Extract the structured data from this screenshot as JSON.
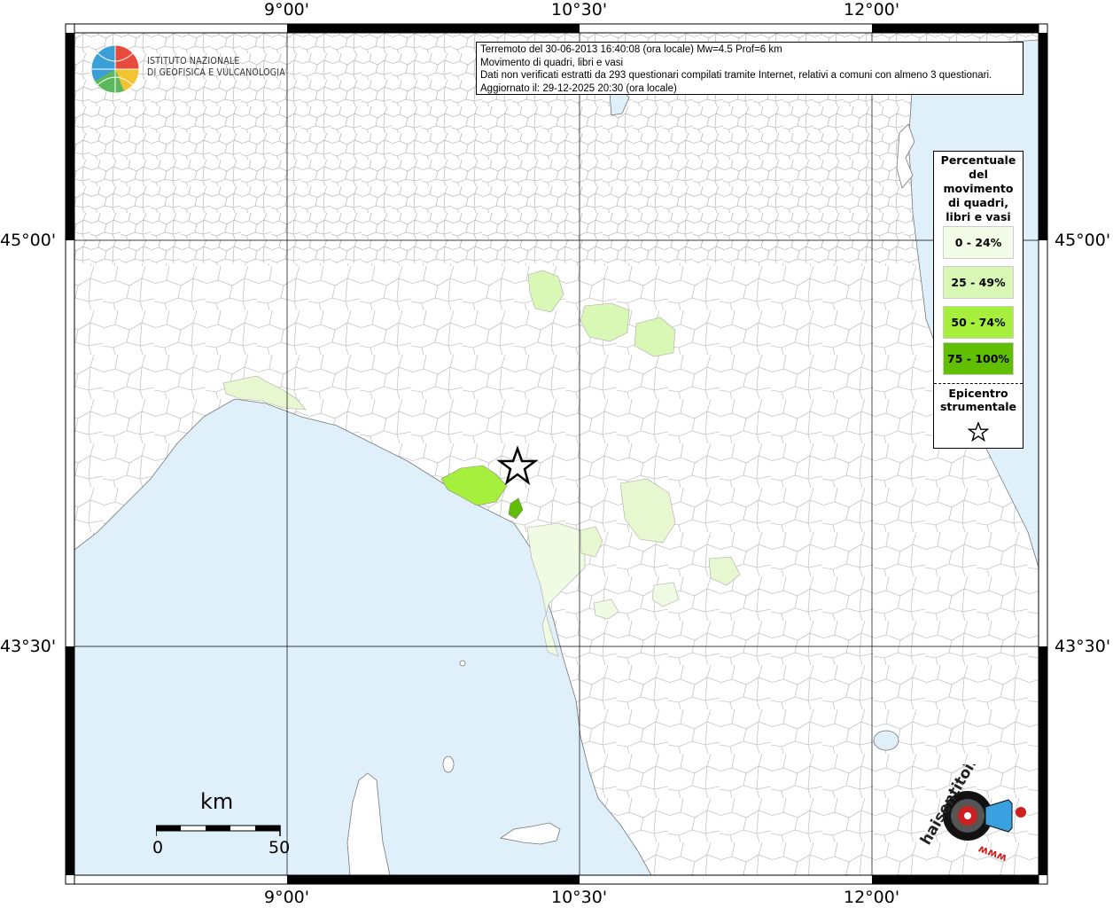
{
  "map": {
    "lon_ticks": [
      "9°00'",
      "10°30'",
      "12°00'"
    ],
    "lat_ticks": [
      "45°00'",
      "43°30'"
    ]
  },
  "info_box": {
    "line1": "Terremoto del 30-06-2013 16:40:08 (ora locale) Mw=4.5 Prof=6 km",
    "line2": "Movimento di quadri, libri e vasi",
    "line3": "Dati non verificati estratti da 293 questionari compilati tramite Internet, relativi a comuni con almeno 3 questionari.",
    "line4": "Aggiornato il: 29-12-2025 20:30 (ora locale)"
  },
  "logo": {
    "line1": "ISTITUTO NAZIONALE",
    "line2": "DI GEOFISICA E VULCANOLOGIA"
  },
  "legend": {
    "title": "Percentuale del movimento di quadri, libri e vasi",
    "title_lines": [
      "Percentuale",
      "del",
      "movimento",
      "di quadri,",
      "libri e vasi"
    ],
    "classes": [
      {
        "label": "0 - 24%",
        "color": "#f2fce6"
      },
      {
        "label": "25 - 49%",
        "color": "#d9f7b5"
      },
      {
        "label": "50 - 74%",
        "color": "#a6ef3c"
      },
      {
        "label": "75 - 100%",
        "color": "#5fbf00"
      }
    ],
    "epicenter_lines": [
      "Epicentro",
      "strumentale"
    ]
  },
  "scale": {
    "unit": "km",
    "start": "0",
    "end": "50"
  },
  "colors": {
    "sea": "#dff0fb",
    "land": "#ffffff",
    "border": "#b0b0b0"
  },
  "sentito": {
    "text": "haisentitoilterremoto.it",
    "www": "www"
  }
}
